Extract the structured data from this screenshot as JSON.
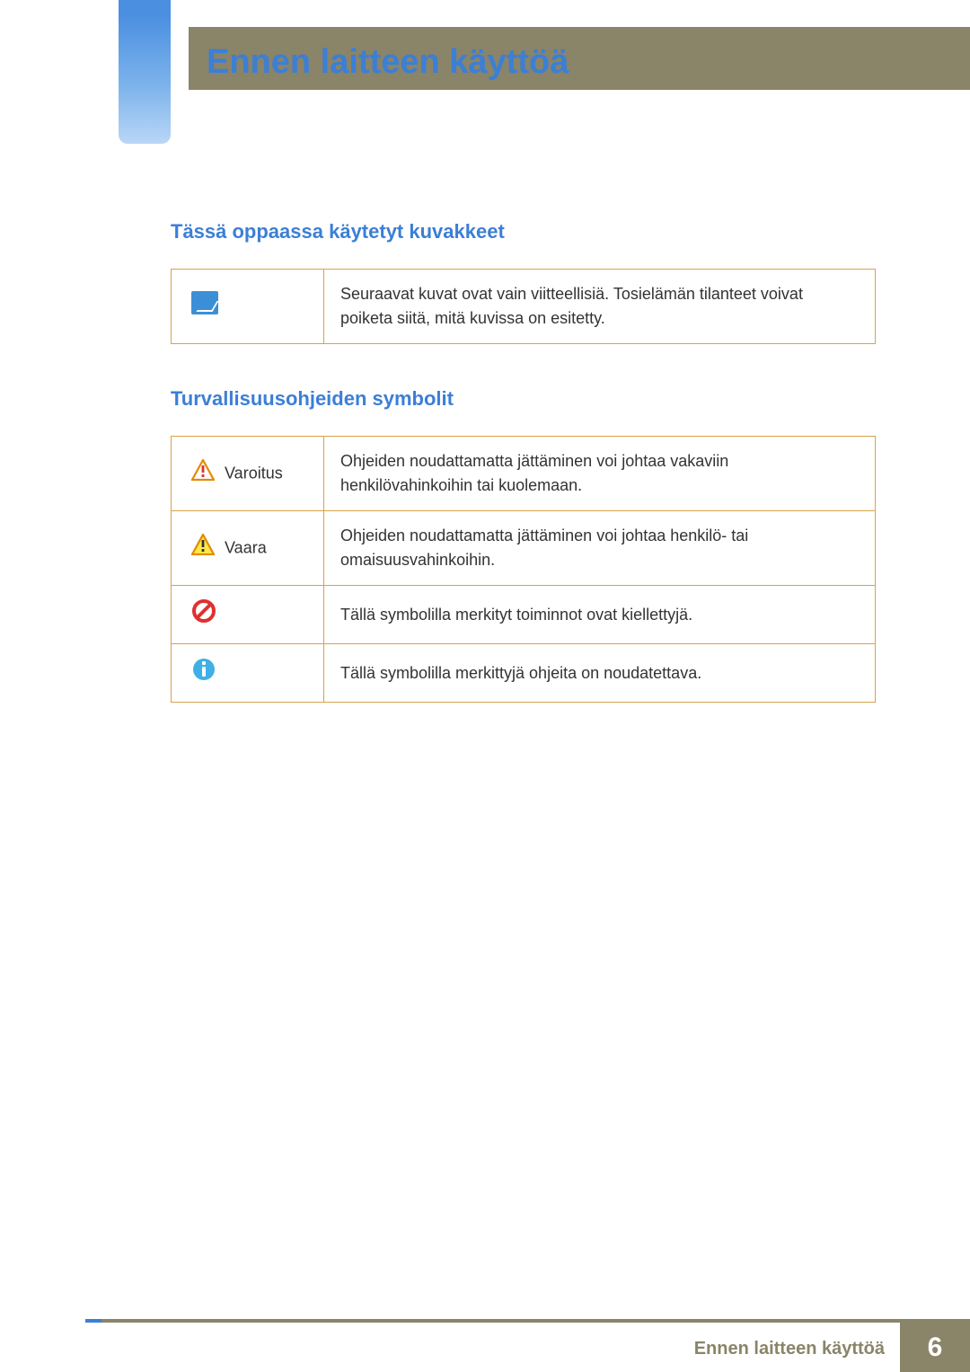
{
  "header": {
    "title": "Ennen laitteen käyttöä"
  },
  "sections": {
    "icons_used": {
      "heading": "Tässä oppaassa käytetyt kuvakkeet",
      "rows": [
        {
          "icon": "note-icon",
          "text": "Seuraavat kuvat ovat vain viitteellisiä. Tosielämän tilanteet voivat poiketa siitä, mitä kuvissa on esitetty."
        }
      ]
    },
    "safety_symbols": {
      "heading": "Turvallisuusohjeiden symbolit",
      "rows": [
        {
          "icon": "warning-icon",
          "label": "Varoitus",
          "text": "Ohjeiden noudattamatta jättäminen voi johtaa vakaviin henkilövahinkoihin tai kuolemaan."
        },
        {
          "icon": "caution-icon",
          "label": "Vaara",
          "text": "Ohjeiden noudattamatta jättäminen voi johtaa henkilö- tai omaisuusvahinkoihin."
        },
        {
          "icon": "prohibit-icon",
          "label": "",
          "text": "Tällä symbolilla merkityt toiminnot ovat kiellettyjä."
        },
        {
          "icon": "info-icon",
          "label": "",
          "text": "Tällä symbolilla merkittyjä ohjeita on noudatettava."
        }
      ]
    }
  },
  "footer": {
    "text": "Ennen laitteen käyttöä",
    "page_number": "6"
  }
}
